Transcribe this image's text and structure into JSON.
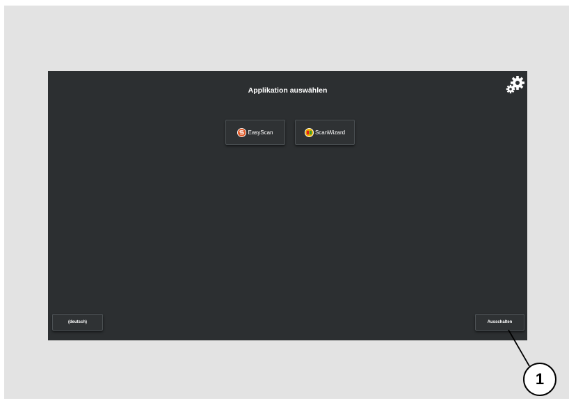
{
  "screen": {
    "title": "Applikation auswählen",
    "settings_icon": "gear-icon"
  },
  "apps": [
    {
      "label": "EasyScan",
      "icon": "easyscan-logo-icon",
      "colors": {
        "outer": "#e05a28",
        "inner": "#ffffff"
      }
    },
    {
      "label": "ScanWizard",
      "icon": "scanwizard-logo-icon",
      "colors": {
        "outer": "#f2b400",
        "inner": "#e02020"
      }
    }
  ],
  "footer": {
    "language_label": "(deutsch)",
    "shutdown_label": "Ausschalten"
  },
  "annotation": {
    "callout_number": "1"
  },
  "colors": {
    "screen_bg": "#2c2f31",
    "frame_bg": "#e3e3e3",
    "text": "#ffffff"
  }
}
